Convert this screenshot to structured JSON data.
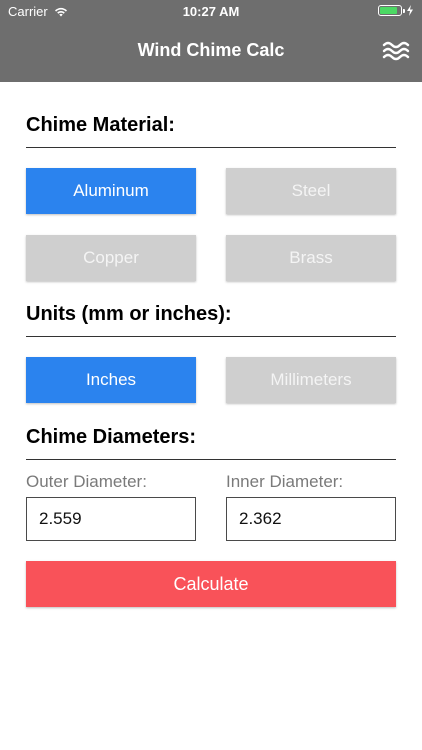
{
  "status_bar": {
    "carrier": "Carrier",
    "time": "10:27 AM",
    "battery_color": "#4cd964"
  },
  "nav": {
    "title": "Wind Chime Calc",
    "menu_icon": "waves-icon"
  },
  "material": {
    "heading": "Chime Material:",
    "options": [
      "Aluminum",
      "Steel",
      "Copper",
      "Brass"
    ],
    "selected": "Aluminum"
  },
  "units": {
    "heading": "Units (mm or inches):",
    "options": [
      "Inches",
      "Millimeters"
    ],
    "selected": "Inches"
  },
  "diameters": {
    "heading": "Chime Diameters:",
    "outer_label": "Outer Diameter:",
    "outer_value": "2.559",
    "inner_label": "Inner Diameter:",
    "inner_value": "2.362"
  },
  "calculate_label": "Calculate",
  "colors": {
    "header_bg": "#6e6e6e",
    "selected": "#2b83ee",
    "unselected": "#cfcfcf",
    "calculate": "#f95259"
  }
}
